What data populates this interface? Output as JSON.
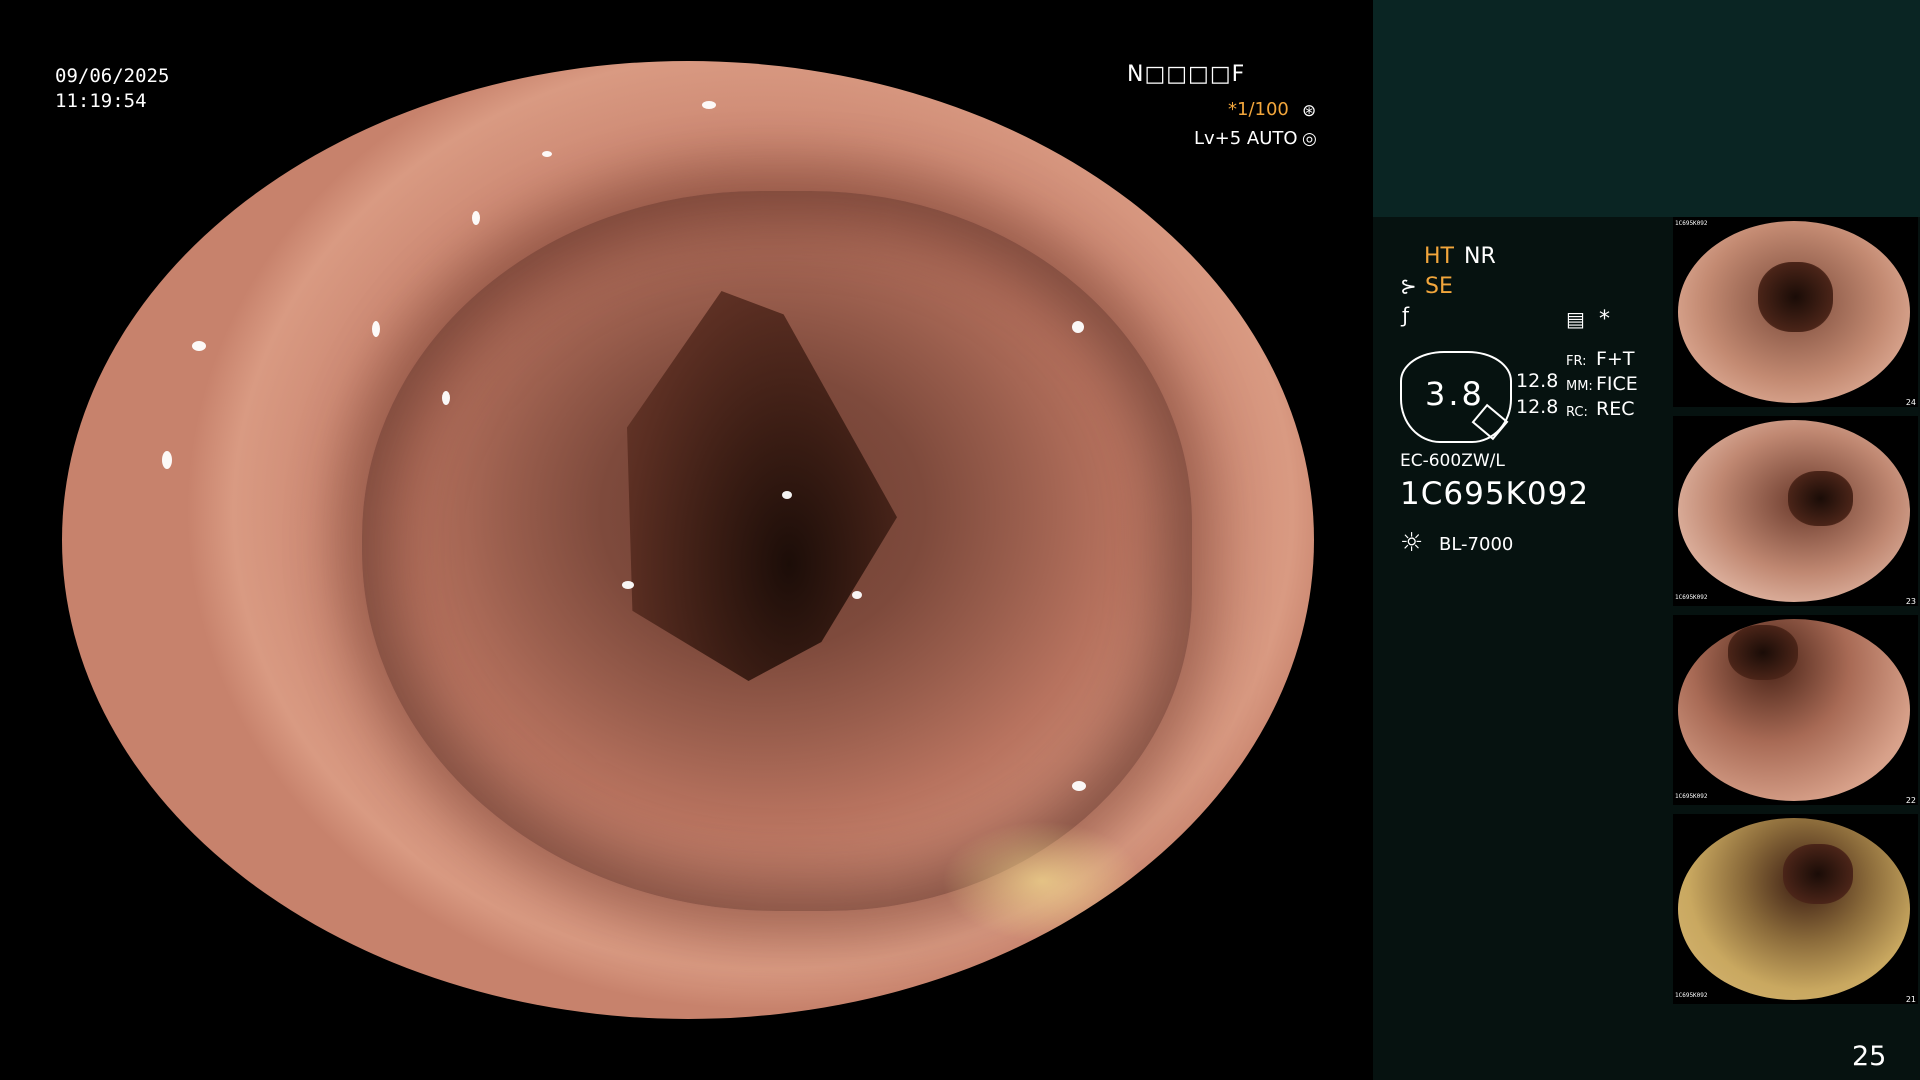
{
  "overlay": {
    "date": "09/06/2025",
    "time": "11:19:54",
    "patient_id": "N□□□□F",
    "shutter": "*1/100",
    "level": "Lv+5 AUTO"
  },
  "panel": {
    "ht": "HT",
    "nr": "NR",
    "se": "SE",
    "star": "*",
    "zoom": "3.8",
    "val1": "12.8",
    "val2": "12.8",
    "fr_label": "FR:",
    "fr_value": "F+T",
    "mm_label": "MM:",
    "mm_value": "FICE",
    "rc_label": "RC:",
    "rc_value": "REC",
    "scope_model": "EC-600ZW/L",
    "scope_serial": "1C695K092",
    "light_source": "BL-7000",
    "page_number": "25"
  },
  "thumbnails": [
    {
      "number": "24",
      "serial": "1C695K092"
    },
    {
      "number": "23",
      "serial": "1C695K092"
    },
    {
      "number": "22",
      "serial": "1C695K092"
    },
    {
      "number": "21",
      "serial": "1C695K092"
    }
  ],
  "icons": {
    "shutter": "aperture-icon",
    "level": "iris-icon",
    "se": "scope-icon",
    "flag": "f-stop-icon",
    "menu": "menu-icon",
    "light": "lamp-icon"
  },
  "colors": {
    "accent": "#f2a63c",
    "panel_bg": "#061210",
    "panel_top": "#0a2523"
  }
}
